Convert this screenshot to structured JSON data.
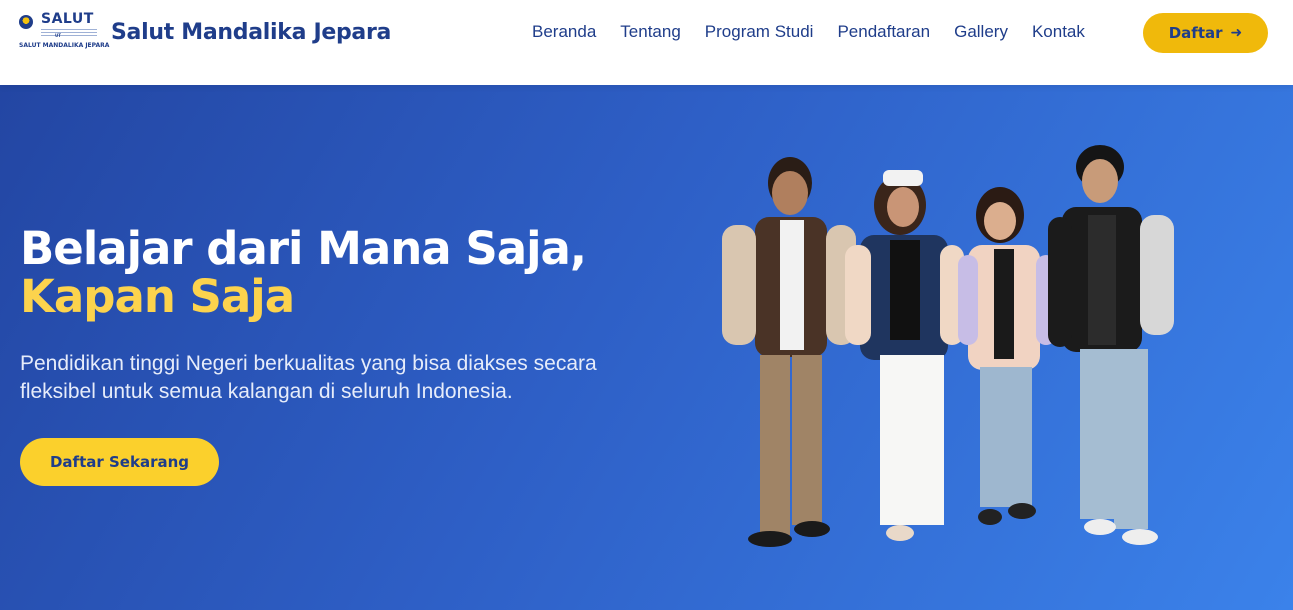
{
  "brand": {
    "logo_word": "SALUT",
    "logo_ut": "UT",
    "logo_caption": "SALUT MANDALIKA JEPARA",
    "title": "Salut Mandalika Jepara"
  },
  "nav": {
    "links": [
      "Beranda",
      "Tentang",
      "Program Studi",
      "Pendaftaran",
      "Gallery",
      "Kontak"
    ],
    "cta_label": "Daftar",
    "cta_icon": "arrow-right-icon"
  },
  "hero": {
    "headline_line1": "Belajar dari Mana Saja,",
    "headline_line2": "Kapan Saja",
    "subtext": "Pendidikan tinggi Negeri berkualitas yang bisa diakses secara fleksibel untuk semua kalangan di seluruh Indonesia.",
    "button_label": "Daftar Sekarang"
  },
  "colors": {
    "brand_blue": "#1f3d8a",
    "accent_yellow": "#f0b90b",
    "headline_yellow": "#fcd34d",
    "hero_gradient_start": "#2346a3",
    "hero_gradient_end": "#3b82ea"
  }
}
